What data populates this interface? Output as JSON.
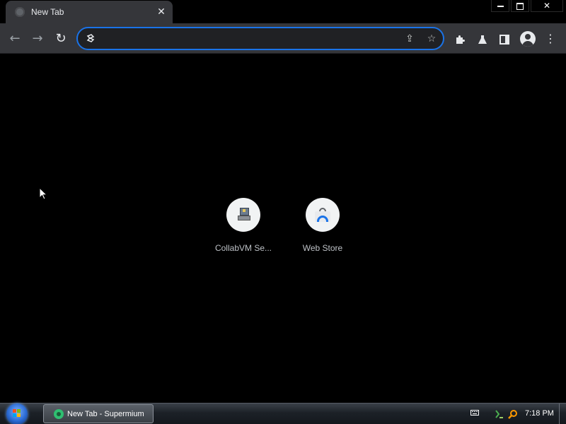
{
  "browser": {
    "tab": {
      "title": "New Tab",
      "close_glyph": "✕",
      "favicon": "globe-icon"
    },
    "window_controls": {
      "minimize": "minimize-icon",
      "maximize": "restore-icon",
      "close_glyph": "✕"
    },
    "toolbar": {
      "back_glyph": "←",
      "forward_glyph": "→",
      "reload_glyph": "↻",
      "omnibox": {
        "value": "",
        "placeholder": "",
        "left_icon": "site-info-icon",
        "share_glyph": "⇪",
        "bookmark_glyph": "☆"
      },
      "extensions_glyph": "✦",
      "labs_glyph": "▲",
      "side_panel_glyph": "◧",
      "menu_glyph": "⋮",
      "focus_color": "#1a73e8"
    }
  },
  "new_tab": {
    "shortcuts": [
      {
        "label": "CollabVM Se...",
        "icon": "collabvm-icon"
      },
      {
        "label": "Web Store",
        "icon": "web-store-icon"
      }
    ]
  },
  "taskbar": {
    "start_icon": "windows-start-orb",
    "active_window": "New Tab - Supermium",
    "tray": {
      "icons": [
        "keyboard-icon",
        "network-icon",
        "search-icon"
      ]
    },
    "time": "7:18 PM"
  }
}
